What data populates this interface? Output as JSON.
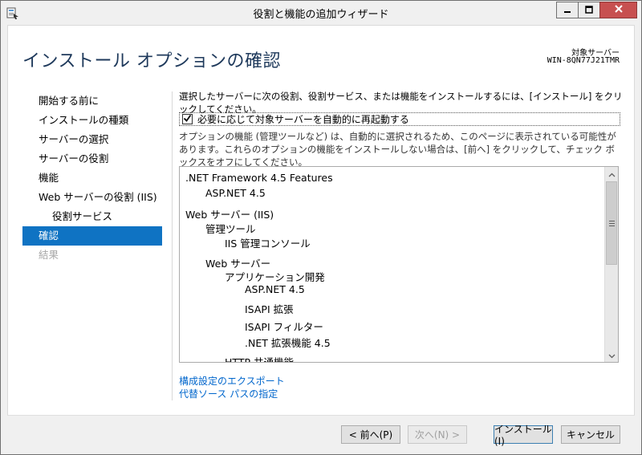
{
  "window": {
    "title": "役割と機能の追加ウィザード"
  },
  "page": {
    "title": "インストール オプションの確認",
    "target_label": "対象サーバー",
    "target_value": "WIN-8QN77J21TMR"
  },
  "nav": {
    "items": [
      {
        "label": "開始する前に"
      },
      {
        "label": "インストールの種類"
      },
      {
        "label": "サーバーの選択"
      },
      {
        "label": "サーバーの役割"
      },
      {
        "label": "機能"
      },
      {
        "label": "Web サーバーの役割 (IIS)"
      },
      {
        "label": "役割サービス"
      },
      {
        "label": "確認"
      },
      {
        "label": "結果"
      }
    ]
  },
  "main": {
    "description": "選択したサーバーに次の役割、役割サービス、または機能をインストールするには、[インストール] をクリックしてください。",
    "restart_label": "必要に応じて対象サーバーを自動的に再起動する",
    "restart_checked": true,
    "option_note": "オプションの機能 (管理ツールなど) は、自動的に選択されるため、このページに表示されている可能性があります。これらのオプションの機能をインストールしない場合は、[前へ] をクリックして、チェック ボックスをオフにしてください。",
    "features": [
      {
        "label": ".NET Framework 4.5 Features",
        "level": 0
      },
      {
        "label": "ASP.NET 4.5",
        "level": 1
      },
      {
        "label": "Web サーバー (IIS)",
        "level": 0
      },
      {
        "label": "管理ツール",
        "level": 1
      },
      {
        "label": "IIS 管理コンソール",
        "level": 2
      },
      {
        "label": "Web サーバー",
        "level": 1
      },
      {
        "label": "アプリケーション開発",
        "level": 2
      },
      {
        "label": "ASP.NET 4.5",
        "level": 3
      },
      {
        "label": "ISAPI 拡張",
        "level": 3
      },
      {
        "label": "ISAPI フィルター",
        "level": 3
      },
      {
        "label": ".NET 拡張機能 4.5",
        "level": 3
      },
      {
        "label": "HTTP 共通機能",
        "level": 2
      }
    ],
    "links": {
      "export": "構成設定のエクスポート",
      "alternate_source": "代替ソース パスの指定"
    }
  },
  "buttons": {
    "prev": "< 前へ(P)",
    "next": "次へ(N) >",
    "install": "インストール(I)",
    "cancel": "キャンセル"
  },
  "colors": {
    "accent": "#0f73c3",
    "title": "#1e395b",
    "link": "#0066cc",
    "close": "#c75050"
  }
}
